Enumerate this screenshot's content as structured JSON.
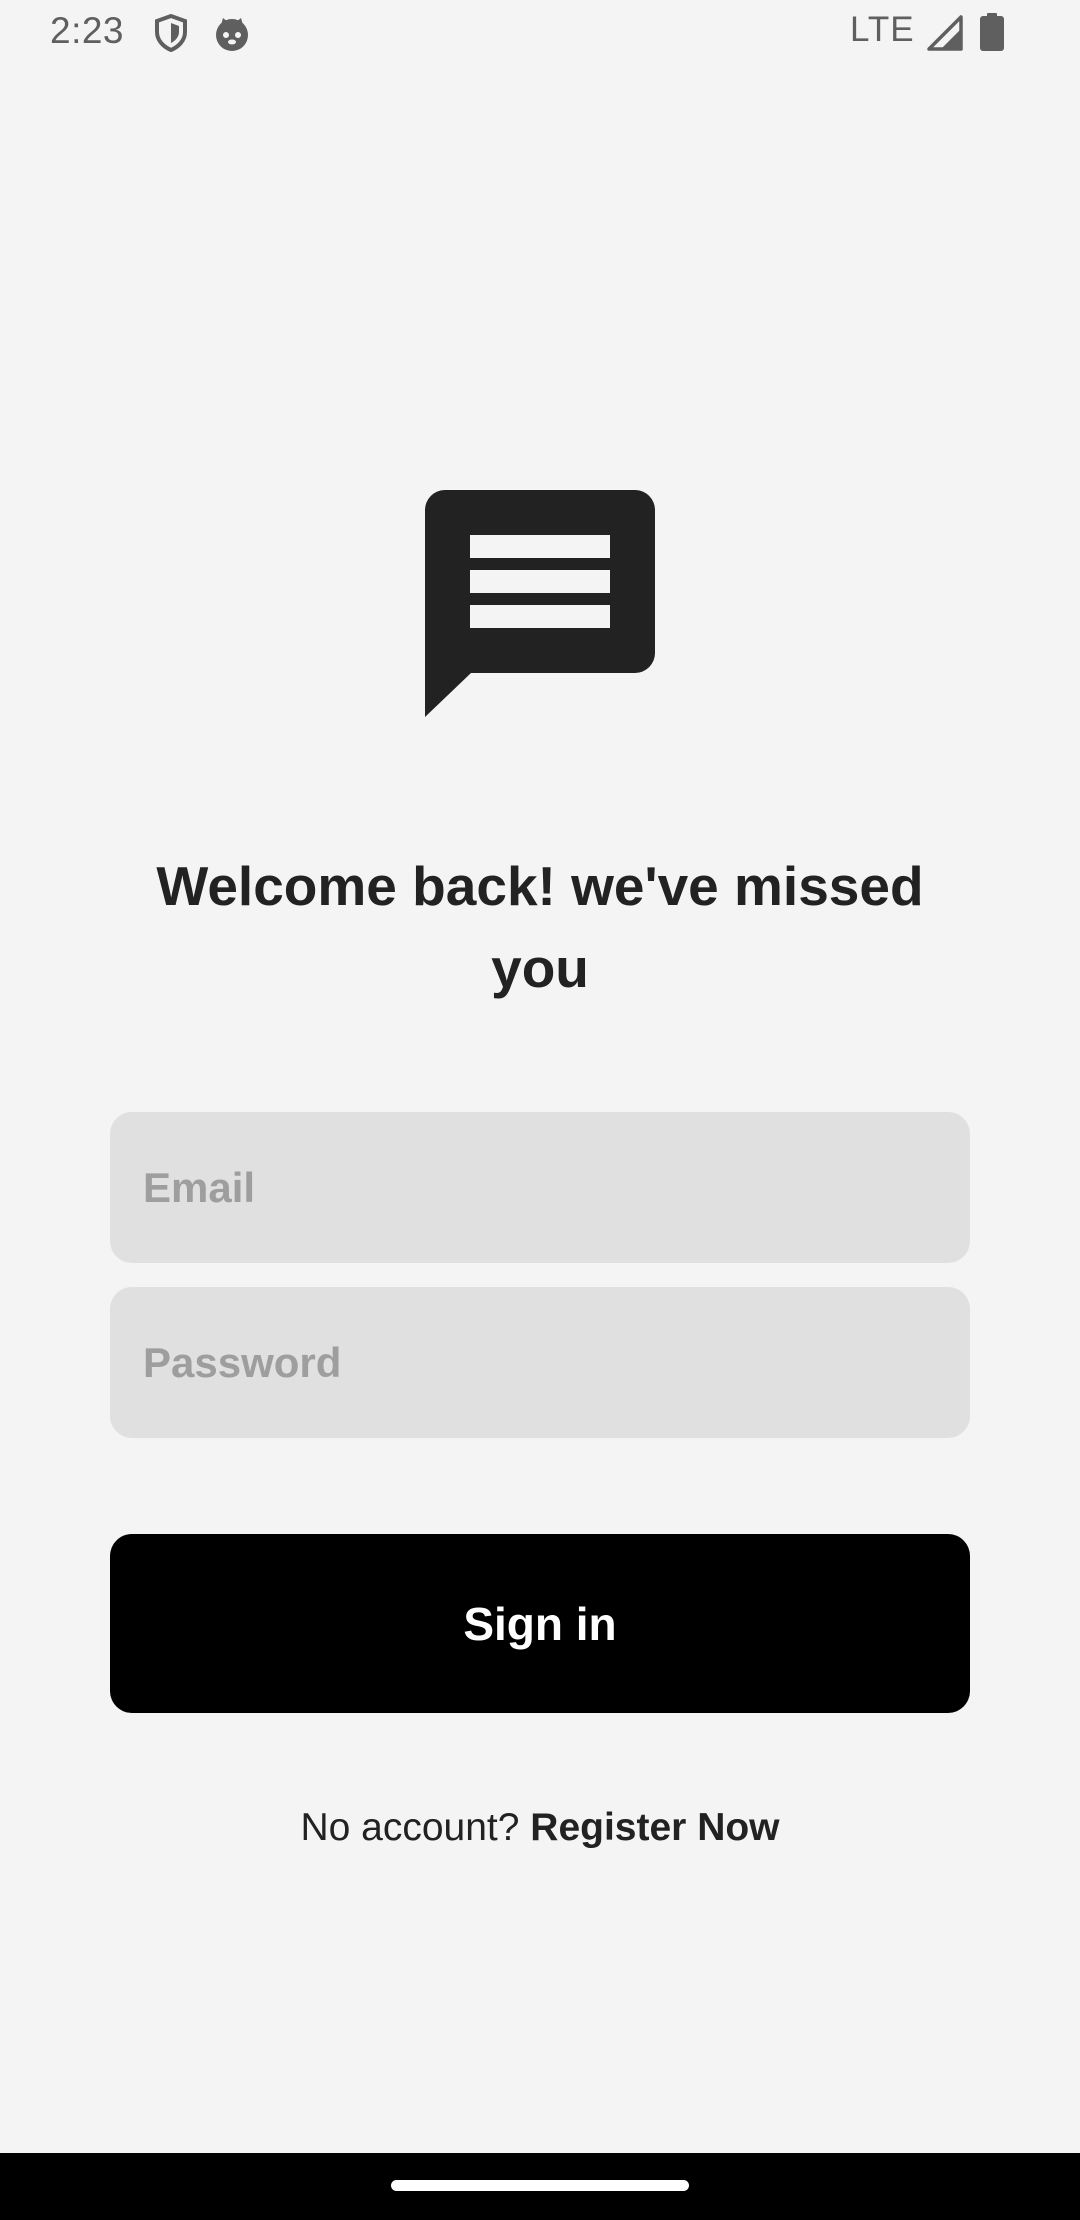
{
  "status_bar": {
    "time": "2:23",
    "network": "LTE",
    "icons": [
      "shield-icon",
      "cat-icon",
      "signal-icon",
      "battery-icon"
    ]
  },
  "logo": {
    "icon": "message-bubble-icon"
  },
  "welcome": {
    "title": "Welcome back! we've missed you"
  },
  "form": {
    "email": {
      "placeholder": "Email",
      "value": ""
    },
    "password": {
      "placeholder": "Password",
      "value": ""
    },
    "signin_label": "Sign in"
  },
  "register": {
    "prompt": "No account?",
    "link_label": "Register Now"
  },
  "colors": {
    "background": "#f4f4f4",
    "field_background": "#e0e0e0",
    "button_background": "#000000",
    "text_primary": "#222222",
    "placeholder": "#9e9e9e"
  }
}
